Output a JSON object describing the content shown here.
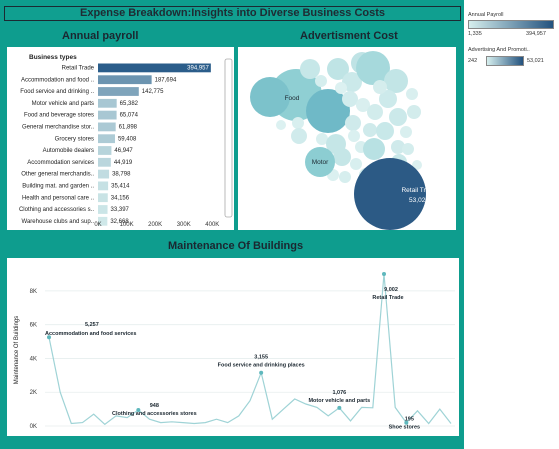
{
  "dashboard_title": "Expense Breakdown:Insights into Diverse Business Costs",
  "colors": {
    "background": "#0e9d8e",
    "bar_dark": "#2b5d8a",
    "bar_light": "#cfe8e9",
    "bubble_big": "#2c5a85",
    "line": "#5fb8bd"
  },
  "legend": {
    "annual_payroll": {
      "title": "Annual Payroll",
      "min": "1,335",
      "max": "394,957"
    },
    "advertising": {
      "title": "Advertising And Promoti..",
      "min": "242",
      "max": "53,021"
    }
  },
  "chart_data": [
    {
      "type": "bar",
      "orientation": "horizontal",
      "title": "Annual payroll",
      "header": "Business types",
      "categories": [
        "Retail Trade",
        "Accommodation and food ..",
        "Food service and drinking ..",
        "Motor vehicle and parts",
        "Food and beverage stores",
        "General merchandise stor..",
        "Grocery stores",
        "Automobile dealers",
        "Accommodation services",
        "Other general merchandis..",
        "Building mat. and garden ..",
        "Health and personal care ..",
        "Clothing and accessories s..",
        "Warehouse clubs and sup.."
      ],
      "values": [
        394957,
        187694,
        142775,
        65382,
        65074,
        61898,
        59408,
        46947,
        44919,
        38798,
        35414,
        34156,
        33397,
        32668
      ],
      "value_labels": [
        "394,957",
        "187,694",
        "142,775",
        "65,382",
        "65,074",
        "61,898",
        "59,408",
        "46,947",
        "44,919",
        "38,798",
        "35,414",
        "34,156",
        "33,397",
        "32,668"
      ],
      "xticks": [
        "0K",
        "100K",
        "200K",
        "300K",
        "400K"
      ],
      "xlim": [
        0,
        420000
      ]
    },
    {
      "type": "bubble",
      "title": "Advertisment Cost",
      "labels": [
        "Food",
        "Motor",
        "Retail Trade"
      ],
      "labeled_values": {
        "Retail Trade": "53,021"
      }
    },
    {
      "type": "line",
      "title": "Maintenance Of Buildings",
      "ylabel": "Maintenance Of Buildings",
      "yticks": [
        "0K",
        "2K",
        "4K",
        "6K",
        "8K"
      ],
      "ylim": [
        0,
        9000
      ],
      "values": [
        5257,
        2000,
        150,
        200,
        700,
        100,
        600,
        500,
        948,
        400,
        200,
        250,
        200,
        150,
        200,
        400,
        200,
        600,
        1500,
        3155,
        400,
        1000,
        1600,
        1300,
        1100,
        600,
        1076,
        300,
        1100,
        1076,
        9002,
        1100,
        195,
        900,
        150,
        1000,
        150
      ],
      "annotations": [
        {
          "index": 0,
          "value": "5,257",
          "label": "Accommodation and food services"
        },
        {
          "index": 8,
          "value": "948",
          "label": "Clothing and accessories stores"
        },
        {
          "index": 19,
          "value": "3,155",
          "label": "Food service and drinking places"
        },
        {
          "index": 26,
          "value": "1,076",
          "label": "Motor vehicle and parts"
        },
        {
          "index": 30,
          "value": "9,002",
          "label": "Retail Trade"
        },
        {
          "index": 32,
          "value": "195",
          "label": "Shoe stores"
        }
      ]
    }
  ]
}
